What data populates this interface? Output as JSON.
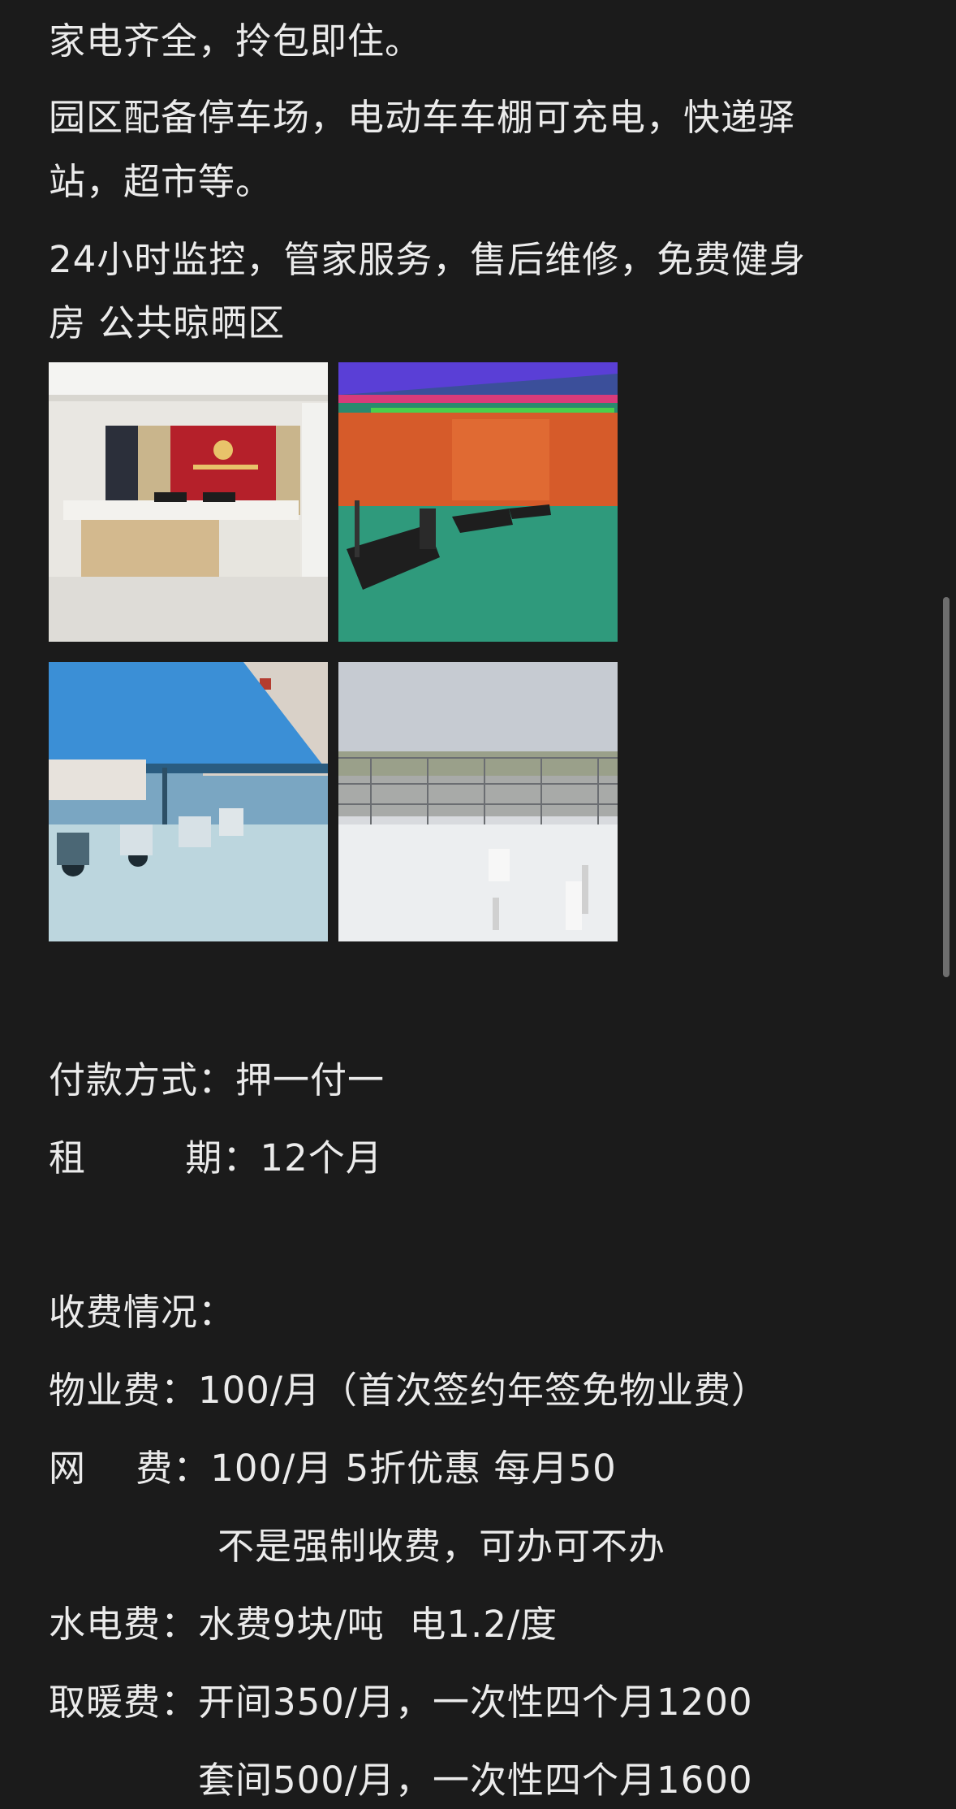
{
  "article": {
    "lines": [
      "家电齐全，拎包即住。",
      "园区配备停车场，电动车车棚可充电，快递驿",
      "站，超市等。",
      "24小时监控，管家服务，售后维修，免费健身",
      "房 公共晾晒区",
      "付款方式：押一付一",
      "租        期：12个月",
      "收费情况：",
      "物业费：100/月（首次签约年签免物业费）",
      "网    费：100/月 5折优惠 每月50",
      "不是强制收费，可办可不办",
      "水电费：水费9块/吨  电1.2/度",
      "取暖费：开间350/月，一次性四个月1200",
      "套间500/月，一次性四个月1600"
    ]
  },
  "photos": [
    {
      "subject": "reception-lobby"
    },
    {
      "subject": "fitness-room"
    },
    {
      "subject": "ebike-charging-shed"
    },
    {
      "subject": "rooftop-drying-area"
    }
  ],
  "colors": {
    "background": "#1b1b1b",
    "text": "#ebebeb",
    "scrollbar": "#6e6e6e"
  }
}
